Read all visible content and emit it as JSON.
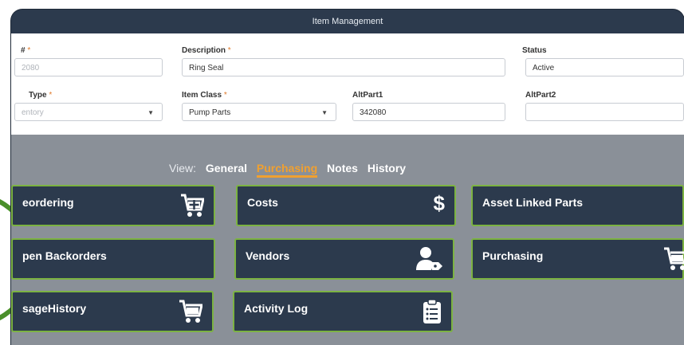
{
  "window": {
    "title": "Item Management"
  },
  "form": {
    "item_no": {
      "label": "#",
      "value": "2080"
    },
    "description": {
      "label": "Description",
      "value": "Ring Seal"
    },
    "status": {
      "label": "Status",
      "value": "Active"
    },
    "type": {
      "label": "Type",
      "value": "entory"
    },
    "item_class": {
      "label": "Item Class",
      "value": "Pump Parts"
    },
    "altpart1": {
      "label": "AltPart1",
      "value": "342080"
    },
    "altpart2": {
      "label": "AltPart2",
      "value": ""
    },
    "required_mark": "*"
  },
  "view": {
    "label": "View:",
    "tabs": [
      "General",
      "Purchasing",
      "Notes",
      "History"
    ],
    "active": "Purchasing"
  },
  "cards": {
    "reordering": {
      "label": "eordering",
      "icon": "cart-plus-icon"
    },
    "costs": {
      "label": "Costs",
      "icon": "dollar-icon"
    },
    "asset_linked_parts": {
      "label": "Asset Linked Parts"
    },
    "open_backorders": {
      "label": "pen Backorders"
    },
    "vendors": {
      "label": "Vendors",
      "icon": "user-tag-icon"
    },
    "purchasing": {
      "label": "Purchasing",
      "icon": "cart-icon"
    },
    "usage_history": {
      "label": "sageHistory",
      "icon": "cart-icon"
    },
    "activity_log": {
      "label": "Activity Log",
      "icon": "clipboard-list-icon"
    }
  },
  "colors": {
    "card_bg": "#2c3a4d",
    "card_border": "#7cb342",
    "panel_bg": "#8a9098",
    "accent": "#f0a030"
  }
}
